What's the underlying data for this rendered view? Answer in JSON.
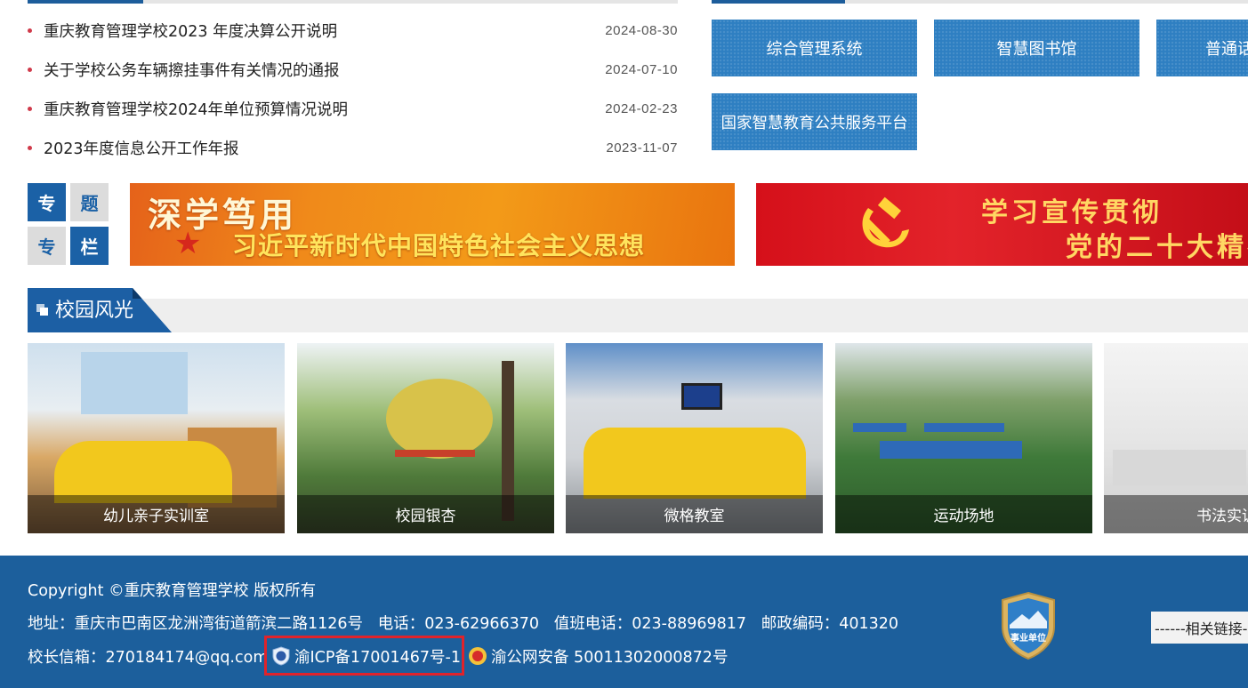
{
  "news": {
    "items": [
      {
        "title": "重庆教育管理学校2023 年度决算公开说明",
        "date": "2024-08-30"
      },
      {
        "title": "关于学校公务车辆擦挂事件有关情况的通报",
        "date": "2024-07-10"
      },
      {
        "title": "重庆教育管理学校2024年单位预算情况说明",
        "date": "2024-02-23"
      },
      {
        "title": "2023年度信息公开工作年报",
        "date": "2023-11-07"
      }
    ]
  },
  "quick_links": {
    "items": [
      {
        "label": "综合管理系统"
      },
      {
        "label": "智慧图书馆"
      },
      {
        "label": "普通话"
      },
      {
        "label": "国家智慧教育公共服务平台"
      }
    ]
  },
  "special_column": {
    "tiles": [
      "专",
      "题",
      "专",
      "栏"
    ]
  },
  "banners": {
    "study": {
      "title": "深学笃用",
      "subtitle": "习近平新时代中国特色社会主义思想"
    },
    "party": {
      "title": "学习宣传贯彻",
      "subtitle": "党的二十大精神"
    }
  },
  "campus": {
    "title": "校园风光",
    "photos": [
      {
        "caption": "幼儿亲子实训室"
      },
      {
        "caption": "校园银杏"
      },
      {
        "caption": "微格教室"
      },
      {
        "caption": "运动场地"
      },
      {
        "caption": "书法实训"
      }
    ]
  },
  "footer": {
    "copyright": "Copyright ©重庆教育管理学校 版权所有",
    "address": "地址：重庆市巴南区龙洲湾街道箭滨二路1126号",
    "phone": "电话：023-62966370",
    "duty_phone": "值班电话：023-88969817",
    "postcode": "邮政编码：401320",
    "principal_email": "校长信箱：270184174@qq.com",
    "icp": "渝ICP备17001467号-1",
    "police": "渝公网安备 50011302000872号",
    "unit_badge": "事业单位",
    "related_links": "------相关链接---"
  },
  "colors": {
    "primary": "#1c5f9c",
    "link_tile": "#2e7fc2",
    "bullet": "#d03a4a",
    "highlight_box": "#e0232b"
  }
}
